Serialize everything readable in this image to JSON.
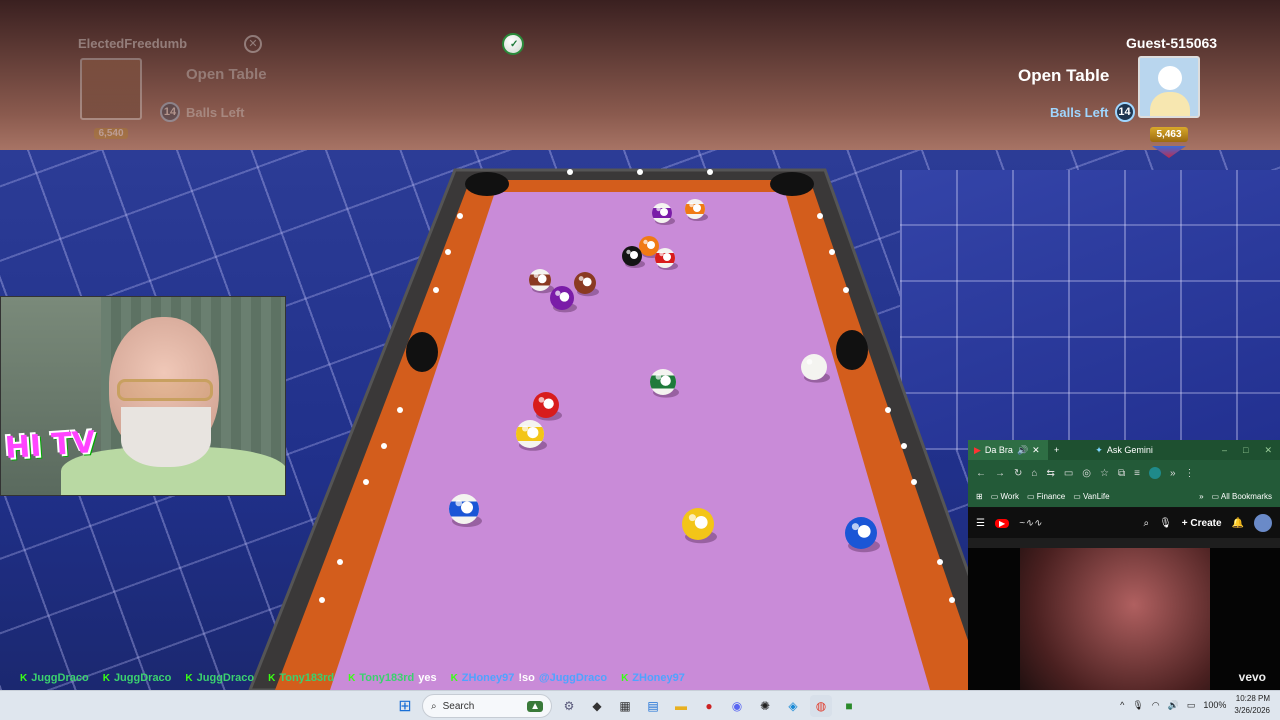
{
  "player_left": {
    "name": "ElectedFreedumb",
    "status": "Open Table",
    "balls_left_label": "Balls Left",
    "balls_left": "14",
    "rank": "6,540",
    "platform_icon": "xbox-icon"
  },
  "player_right": {
    "name": "Guest-515063",
    "status": "Open Table",
    "balls_left_label": "Balls Left",
    "balls_left": "14",
    "rank": "5,463"
  },
  "turn_indicator": "cue-ball-icon",
  "table": {
    "felt_color": "#c98bd8",
    "rail_color": "#d35d1c"
  },
  "balls": [
    {
      "id": "1",
      "color": "#f3c518",
      "stripe": false
    },
    {
      "id": "2",
      "color": "#1a56d6",
      "stripe": false
    },
    {
      "id": "3",
      "color": "#d81c1c",
      "stripe": false
    },
    {
      "id": "4",
      "color": "#7a1ca8",
      "stripe": false
    },
    {
      "id": "5",
      "color": "#f07a14",
      "stripe": false
    },
    {
      "id": "6",
      "color": "#1f7a3a",
      "stripe": false
    },
    {
      "id": "7",
      "color": "#8a3a22",
      "stripe": false
    },
    {
      "id": "8",
      "color": "#141414",
      "stripe": false
    },
    {
      "id": "9",
      "color": "#f3c518",
      "stripe": true
    },
    {
      "id": "10",
      "color": "#1a56d6",
      "stripe": true
    },
    {
      "id": "11",
      "color": "#d81c1c",
      "stripe": true
    },
    {
      "id": "12",
      "color": "#7a1ca8",
      "stripe": true
    },
    {
      "id": "13",
      "color": "#f07a14",
      "stripe": true
    },
    {
      "id": "14",
      "color": "#1f7a3a",
      "stripe": true
    },
    {
      "id": "15",
      "color": "#8a3a22",
      "stripe": true
    },
    {
      "id": "cue",
      "color": "#f4f4f0",
      "stripe": false
    }
  ],
  "webcam": {
    "overlay_text": "HI TV"
  },
  "browser": {
    "tab_title": "Da Bra",
    "gemini": "Ask Gemini",
    "bookmarks": [
      "Work",
      "Finance",
      "VanLife"
    ],
    "all_bookmarks": "All Bookmarks",
    "create_label": "Create",
    "watermark": "vevo"
  },
  "chat_ticker": [
    {
      "name": "JuggDraco",
      "msg": ""
    },
    {
      "name": "JuggDraco",
      "msg": ""
    },
    {
      "name": "JuggDraco",
      "msg": ""
    },
    {
      "name": "Tony183rd",
      "msg": ""
    },
    {
      "name": "Tony183rd",
      "msg": "yes"
    },
    {
      "name": "ZHoney97",
      "msg": "!so",
      "mention": "@JuggDraco"
    },
    {
      "name": "ZHoney97",
      "msg": ""
    }
  ],
  "taskbar": {
    "search_placeholder": "Search",
    "battery": "100%",
    "time": "10:28 PM",
    "date": "3/26/2026"
  }
}
